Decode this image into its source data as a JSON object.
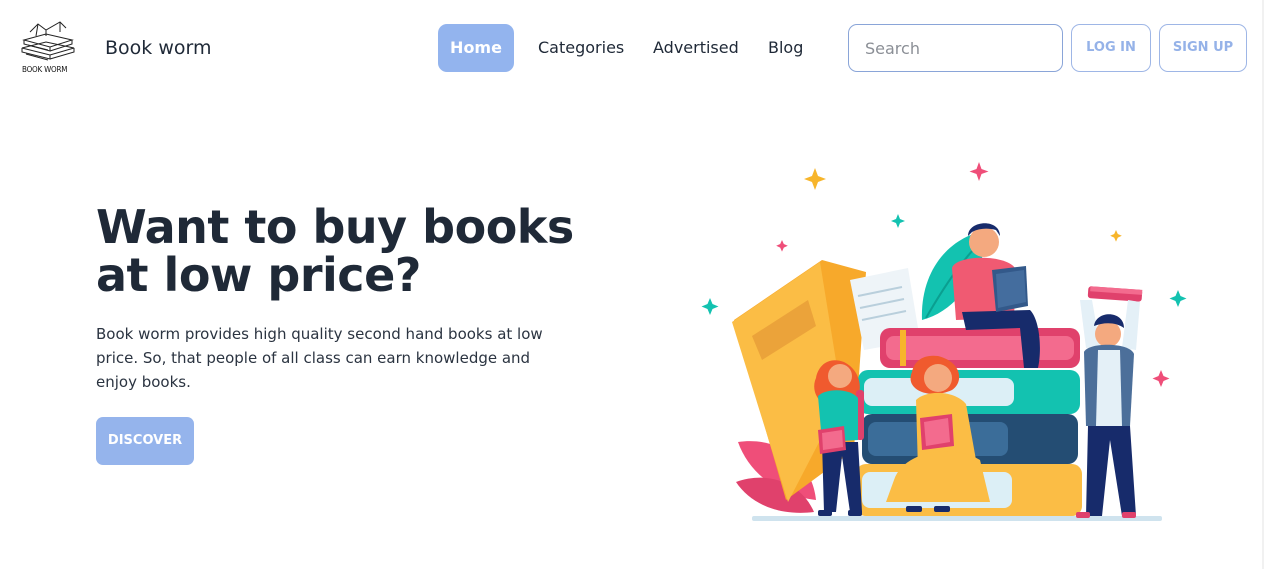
{
  "navbar": {
    "logo_caption": "BOOK WORM",
    "brand": "Book worm",
    "links": [
      {
        "label": "Home",
        "active": true
      },
      {
        "label": "Categories"
      },
      {
        "label": "Advertised"
      },
      {
        "label": "Blog"
      }
    ],
    "search": {
      "placeholder": "Search",
      "value": ""
    },
    "login_label": "LOG IN",
    "signup_label": "SIGN UP"
  },
  "hero": {
    "title": "Want to buy books at low price?",
    "description": "Book worm provides high quality second hand books at low price. So, that people of all class can earn knowledge and enjoy books.",
    "cta_label": "DISCOVER"
  },
  "theme": {
    "accent": "#93b4ee",
    "text": "#1f2937",
    "outline": "#9eb6e6"
  },
  "illustration": {
    "icon": "people-reading-books-illustration"
  }
}
